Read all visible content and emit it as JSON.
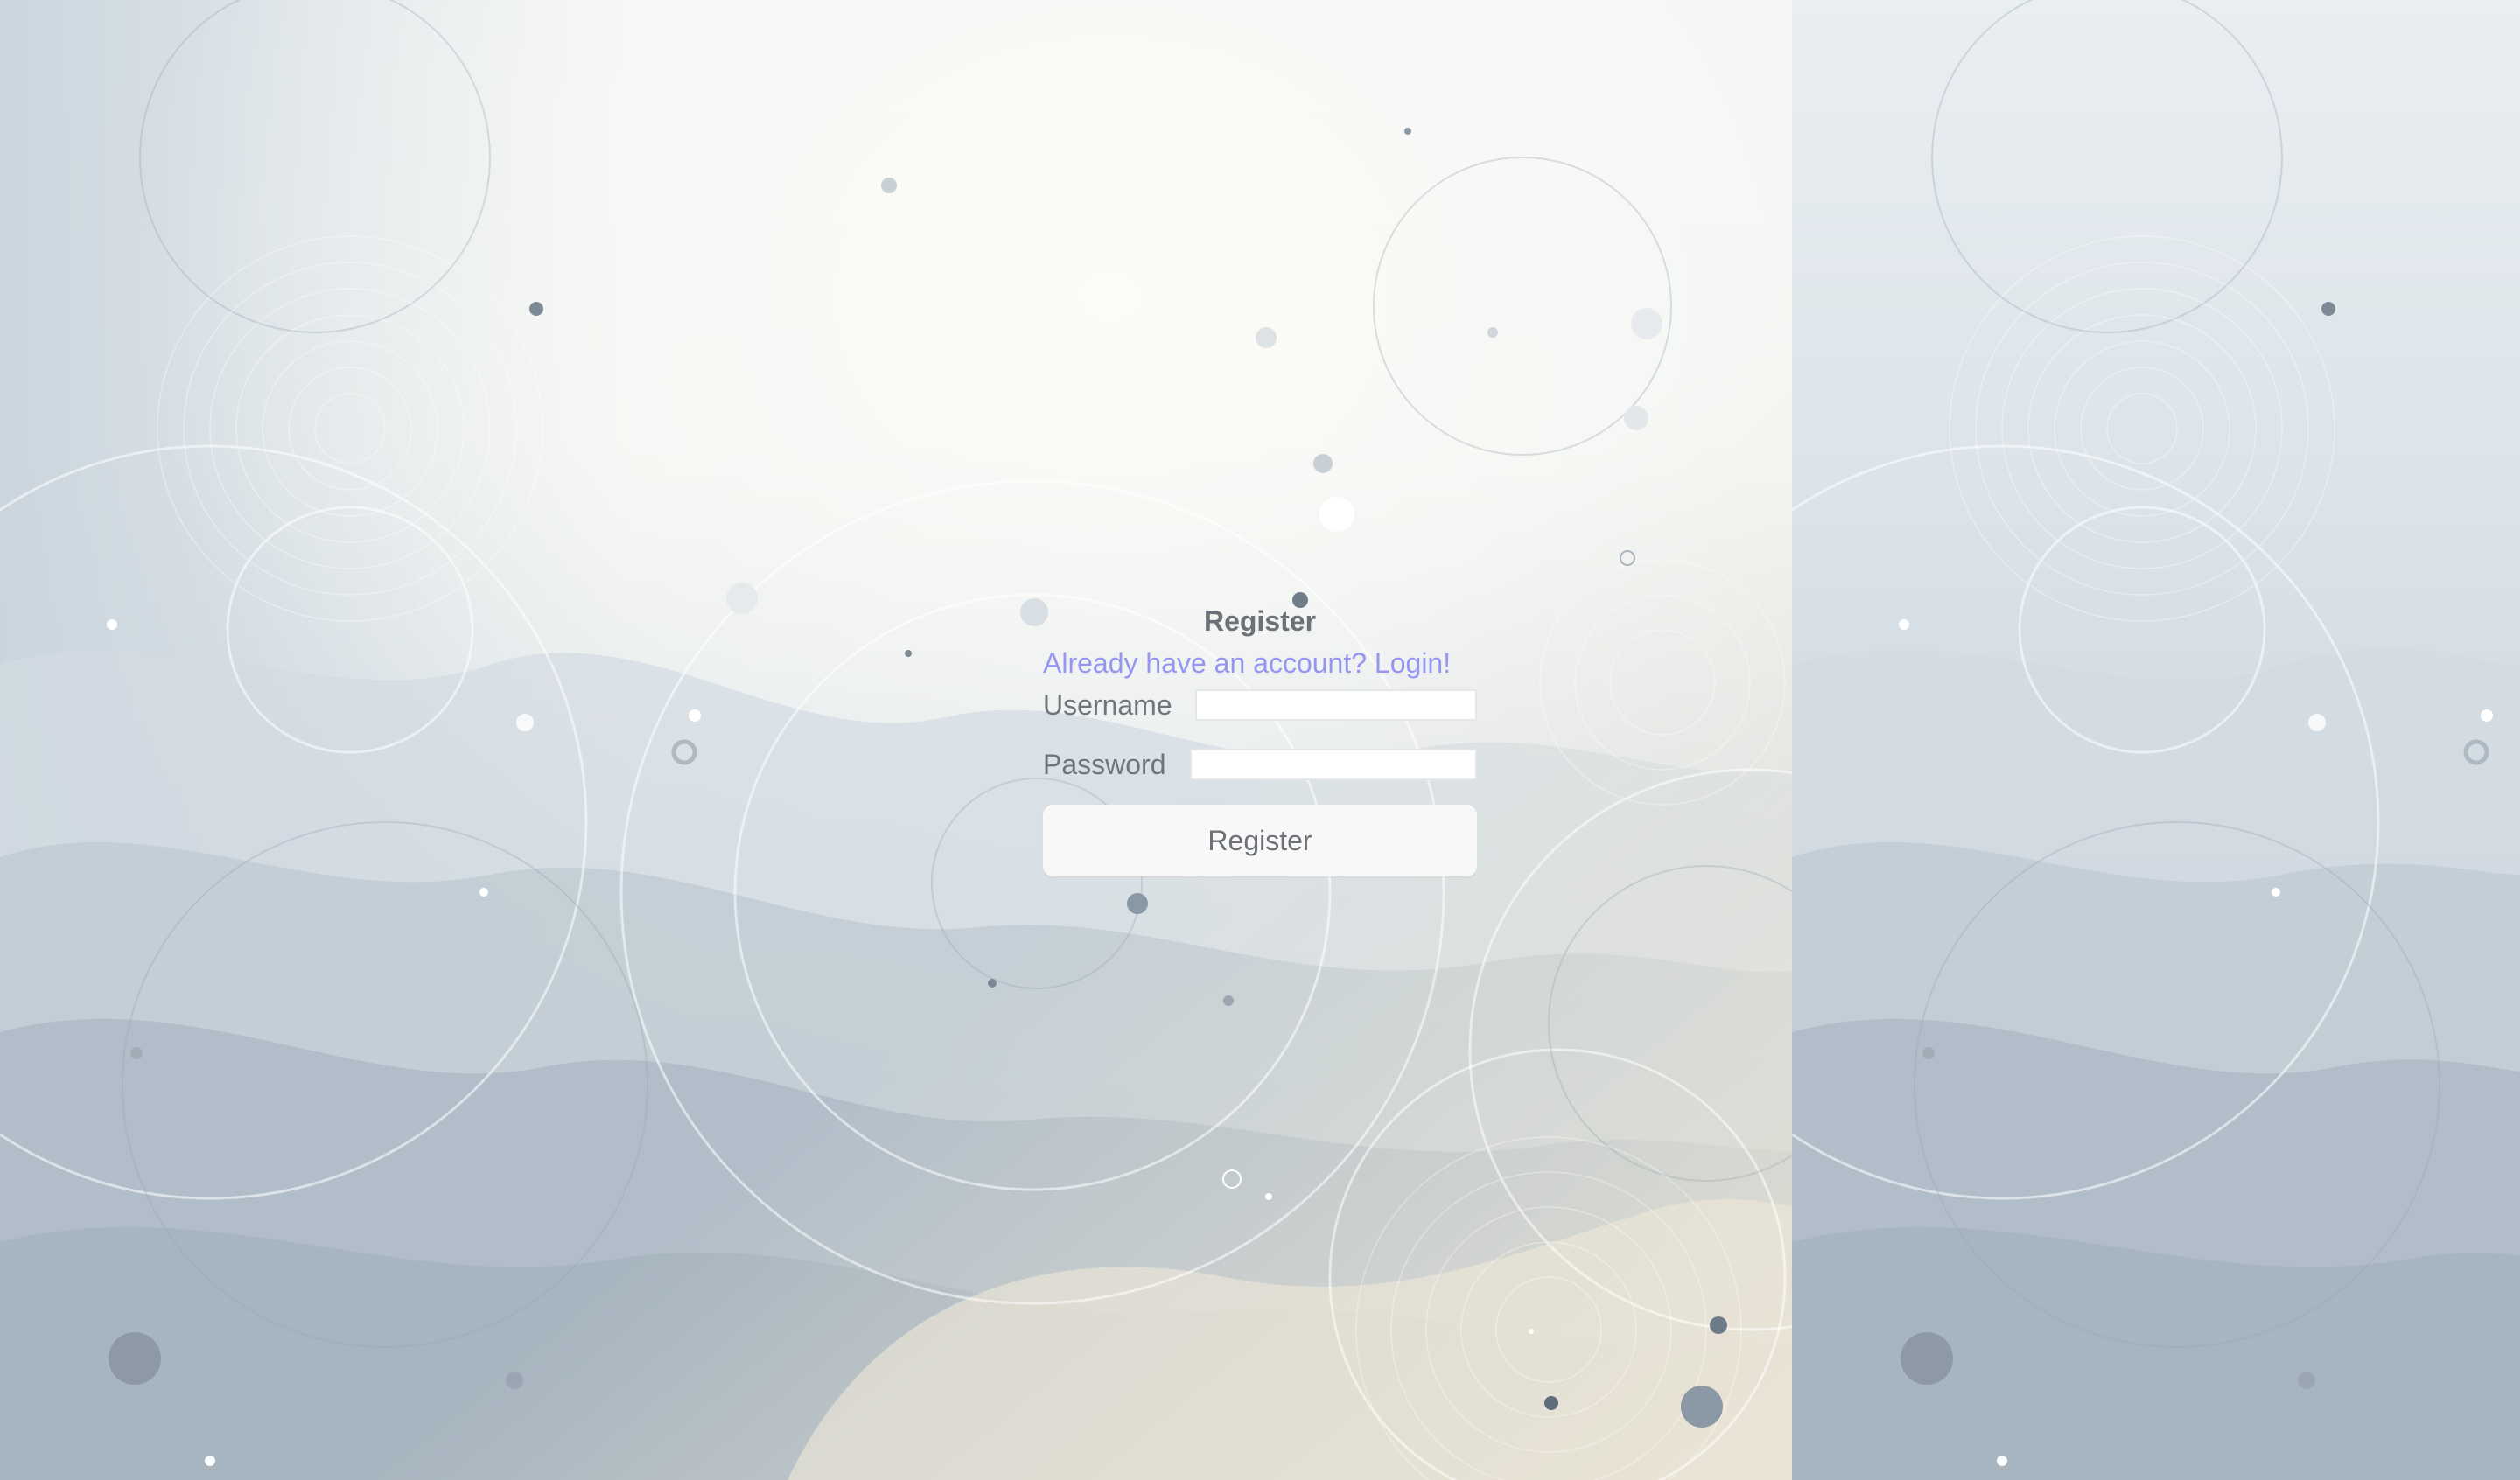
{
  "register_form": {
    "title": "Register",
    "login_link": "Already have an account? Login!",
    "username_label": "Username",
    "username_value": "",
    "password_label": "Password",
    "password_value": "",
    "submit_label": "Register"
  },
  "colors": {
    "link": "#9596f2",
    "text": "#6a7178",
    "button_bg": "#f8f8f9",
    "bg_light": "#f7f8f5",
    "bg_blue_grey": "#b6c3cd"
  }
}
